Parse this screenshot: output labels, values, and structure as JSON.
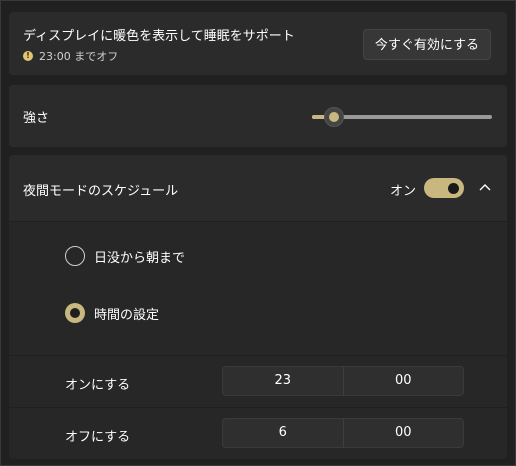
{
  "night_light": {
    "title": "ディスプレイに暖色を表示して睡眠をサポート",
    "status": "23:00 までオフ",
    "status_icon": "info-icon",
    "turn_on_now_label": "今すぐ有効にする"
  },
  "strength": {
    "label": "強さ",
    "value_percent": 12
  },
  "schedule": {
    "label": "夜間モードのスケジュール",
    "toggle_state": "オン",
    "toggle_on": true,
    "expanded": true,
    "options": [
      {
        "label": "日没から朝まで",
        "selected": false
      },
      {
        "label": "時間の設定",
        "selected": true
      }
    ],
    "turn_on": {
      "label": "オンにする",
      "hour": "23",
      "minute": "00"
    },
    "turn_off": {
      "label": "オフにする",
      "hour": "6",
      "minute": "00"
    }
  },
  "colors": {
    "accent": "#c8b880",
    "background": "#202020",
    "card": "#2b2b2b"
  }
}
